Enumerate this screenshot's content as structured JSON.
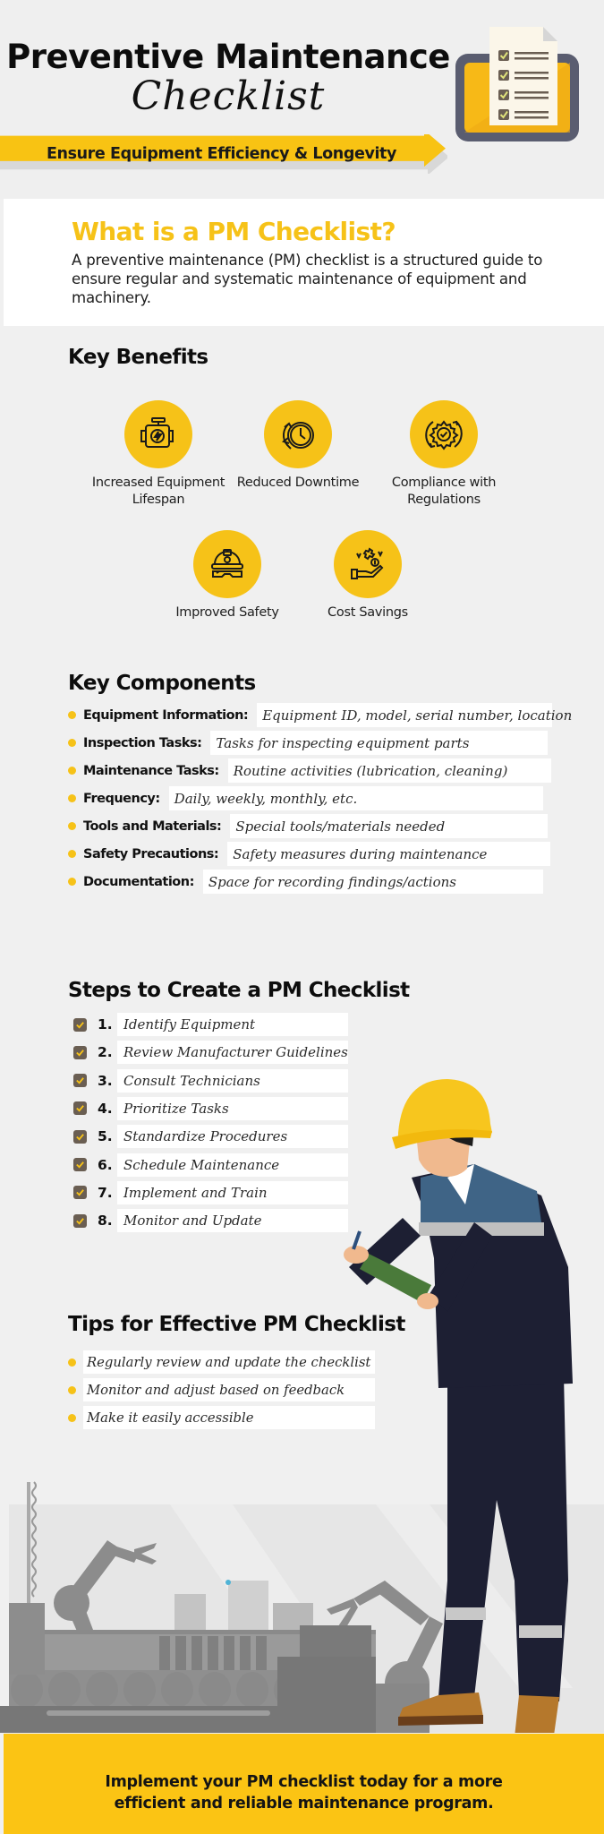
{
  "header": {
    "title_line1": "Preventive Maintenance",
    "title_line2": "Checklist",
    "banner_text": "Ensure Equipment Efficiency & Longevity",
    "icon": "clipboard-checklist-icon"
  },
  "intro": {
    "title": "What is a PM Checklist?",
    "body": "A preventive maintenance (PM) checklist is a structured guide to ensure regular and systematic maintenance of equipment and machinery."
  },
  "benefits": {
    "title": "Key Benefits",
    "items": [
      {
        "label": "Increased Equipment Lifespan",
        "icon": "engine-icon"
      },
      {
        "label": "Reduced Downtime",
        "icon": "clock-rewind-icon"
      },
      {
        "label": "Compliance with Regulations",
        "icon": "gear-check-icon"
      },
      {
        "label": "Improved Safety",
        "icon": "hardhat-goggles-icon"
      },
      {
        "label": "Cost Savings",
        "icon": "hand-coin-icon"
      }
    ]
  },
  "components": {
    "title": "Key Components",
    "items": [
      {
        "label": "Equipment Information:",
        "value": "Equipment ID, model, serial number, location"
      },
      {
        "label": "Inspection Tasks:",
        "value": "Tasks for inspecting equipment parts"
      },
      {
        "label": "Maintenance Tasks:",
        "value": "Routine activities (lubrication, cleaning)"
      },
      {
        "label": "Frequency:",
        "value": "Daily, weekly, monthly, etc."
      },
      {
        "label": "Tools and Materials:",
        "value": "Special tools/materials needed"
      },
      {
        "label": "Safety Precautions:",
        "value": "Safety measures during maintenance"
      },
      {
        "label": "Documentation:",
        "value": "Space for recording findings/actions"
      }
    ]
  },
  "steps": {
    "title": "Steps to Create a PM Checklist",
    "items": [
      {
        "num": "1.",
        "text": "Identify Equipment",
        "checked": true
      },
      {
        "num": "2.",
        "text": "Review Manufacturer Guidelines",
        "checked": true
      },
      {
        "num": "3.",
        "text": "Consult Technicians",
        "checked": true
      },
      {
        "num": "4.",
        "text": "Prioritize Tasks",
        "checked": true
      },
      {
        "num": "5.",
        "text": "Standardize Procedures",
        "checked": true
      },
      {
        "num": "6.",
        "text": "Schedule Maintenance",
        "checked": true
      },
      {
        "num": "7.",
        "text": "Implement and Train",
        "checked": true
      },
      {
        "num": "8.",
        "text": "Monitor and Update",
        "checked": true
      }
    ]
  },
  "tips": {
    "title": "Tips for Effective PM Checklist",
    "items": [
      "Regularly review and update the checklist",
      "Monitor and adjust based on feedback",
      "Make it easily accessible"
    ]
  },
  "footer": {
    "line1": "Implement your PM checklist today for a more",
    "line2": "efficient and reliable maintenance program."
  },
  "colors": {
    "accent_yellow": "#f6c218",
    "footer_yellow": "#fbc414",
    "checkbox_brown": "#6a5e52",
    "background": "#f0f0f0",
    "navy": "#1d1f33"
  }
}
